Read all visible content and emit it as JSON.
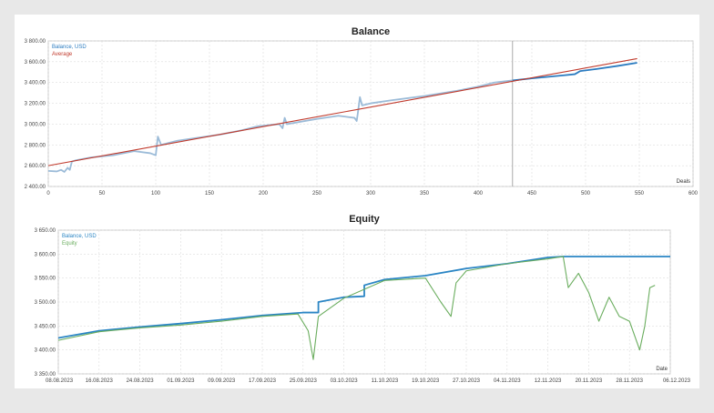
{
  "chart_data": [
    {
      "type": "line",
      "title": "Balance",
      "xlabel": "Deals",
      "xlim": [
        0,
        600
      ],
      "ylim": [
        2400,
        3800
      ],
      "x_ticks": [
        0,
        50,
        100,
        150,
        200,
        250,
        300,
        350,
        400,
        450,
        500,
        550,
        600
      ],
      "y_ticks": [
        2400,
        2600,
        2800,
        3000,
        3200,
        3400,
        3600,
        3800
      ],
      "x_tick_labels": [
        "0",
        "50",
        "100",
        "150",
        "200",
        "250",
        "300",
        "350",
        "400",
        "450",
        "500",
        "550",
        "600"
      ],
      "y_tick_labels": [
        "2 400.00",
        "2 600.00",
        "2 800.00",
        "3 000.00",
        "3 200.00",
        "3 400.00",
        "3 600.00",
        "3 800.00"
      ],
      "grid": true,
      "legend_position": "top-left",
      "divider_x": 432,
      "series": [
        {
          "name": "Balance, USD",
          "color": "#9bbbd8",
          "color_forward": "#2a7bc0",
          "points": [
            [
              0,
              2550
            ],
            [
              8,
              2545
            ],
            [
              12,
              2560
            ],
            [
              15,
              2540
            ],
            [
              18,
              2580
            ],
            [
              20,
              2560
            ],
            [
              22,
              2640
            ],
            [
              25,
              2650
            ],
            [
              40,
              2680
            ],
            [
              60,
              2700
            ],
            [
              80,
              2740
            ],
            [
              95,
              2720
            ],
            [
              100,
              2700
            ],
            [
              102,
              2880
            ],
            [
              105,
              2800
            ],
            [
              120,
              2840
            ],
            [
              140,
              2870
            ],
            [
              160,
              2900
            ],
            [
              180,
              2940
            ],
            [
              195,
              2980
            ],
            [
              215,
              3000
            ],
            [
              218,
              2960
            ],
            [
              220,
              3060
            ],
            [
              222,
              3000
            ],
            [
              250,
              3050
            ],
            [
              270,
              3080
            ],
            [
              285,
              3060
            ],
            [
              287,
              3030
            ],
            [
              288,
              3100
            ],
            [
              290,
              3260
            ],
            [
              292,
              3180
            ],
            [
              300,
              3200
            ],
            [
              320,
              3230
            ],
            [
              350,
              3270
            ],
            [
              380,
              3320
            ],
            [
              400,
              3360
            ],
            [
              415,
              3400
            ],
            [
              432,
              3420
            ],
            [
              450,
              3440
            ],
            [
              480,
              3470
            ],
            [
              490,
              3480
            ],
            [
              495,
              3510
            ],
            [
              510,
              3530
            ],
            [
              530,
              3560
            ],
            [
              548,
              3590
            ]
          ]
        },
        {
          "name": "Average",
          "color": "#c0392b",
          "points": [
            [
              0,
              2600
            ],
            [
              548,
              3630
            ]
          ]
        }
      ]
    },
    {
      "type": "line",
      "title": "Equity",
      "xlabel": "Date",
      "ylim": [
        3350,
        3650
      ],
      "categories": [
        "08.08.2023",
        "16.08.2023",
        "24.08.2023",
        "01.09.2023",
        "09.09.2023",
        "17.09.2023",
        "25.09.2023",
        "03.10.2023",
        "11.10.2023",
        "19.10.2023",
        "27.10.2023",
        "04.11.2023",
        "12.11.2023",
        "20.11.2023",
        "28.11.2023",
        "06.12.2023"
      ],
      "y_ticks": [
        3350,
        3400,
        3450,
        3500,
        3550,
        3600,
        3650
      ],
      "y_tick_labels": [
        "3 350.00",
        "3 400.00",
        "3 450.00",
        "3 500.00",
        "3 550.00",
        "3 600.00",
        "3 650.00"
      ],
      "grid": true,
      "legend_position": "top-left",
      "series": [
        {
          "name": "Balance, USD",
          "color": "#2a85c4",
          "points": [
            [
              "08.08.2023",
              3425
            ],
            [
              "16.08.2023",
              3440
            ],
            [
              "24.08.2023",
              3448
            ],
            [
              "01.09.2023",
              3455
            ],
            [
              "09.09.2023",
              3463
            ],
            [
              "17.09.2023",
              3472
            ],
            [
              "25.09.2023",
              3478
            ],
            [
              "28.09.2023",
              3478
            ],
            [
              "28.09.2023",
              3500
            ],
            [
              "03.10.2023",
              3510
            ],
            [
              "07.10.2023",
              3512
            ],
            [
              "07.10.2023",
              3535
            ],
            [
              "11.10.2023",
              3547
            ],
            [
              "19.10.2023",
              3555
            ],
            [
              "27.10.2023",
              3570
            ],
            [
              "04.11.2023",
              3580
            ],
            [
              "12.11.2023",
              3593
            ],
            [
              "15.11.2023",
              3595
            ],
            [
              "06.12.2023",
              3595
            ]
          ]
        },
        {
          "name": "Equity",
          "color": "#6aad5e",
          "points": [
            [
              "08.08.2023",
              3420
            ],
            [
              "16.08.2023",
              3438
            ],
            [
              "24.08.2023",
              3446
            ],
            [
              "01.09.2023",
              3452
            ],
            [
              "09.09.2023",
              3460
            ],
            [
              "17.09.2023",
              3470
            ],
            [
              "24.09.2023",
              3475
            ],
            [
              "26.09.2023",
              3440
            ],
            [
              "27.09.2023",
              3380
            ],
            [
              "28.09.2023",
              3470
            ],
            [
              "03.10.2023",
              3508
            ],
            [
              "11.10.2023",
              3545
            ],
            [
              "19.10.2023",
              3550
            ],
            [
              "22.10.2023",
              3500
            ],
            [
              "24.10.2023",
              3470
            ],
            [
              "25.10.2023",
              3540
            ],
            [
              "27.10.2023",
              3565
            ],
            [
              "04.11.2023",
              3580
            ],
            [
              "12.11.2023",
              3590
            ],
            [
              "15.11.2023",
              3595
            ],
            [
              "16.11.2023",
              3530
            ],
            [
              "18.11.2023",
              3560
            ],
            [
              "20.11.2023",
              3520
            ],
            [
              "22.11.2023",
              3460
            ],
            [
              "24.11.2023",
              3510
            ],
            [
              "26.11.2023",
              3470
            ],
            [
              "28.11.2023",
              3460
            ],
            [
              "30.11.2023",
              3400
            ],
            [
              "01.12.2023",
              3450
            ],
            [
              "02.12.2023",
              3530
            ],
            [
              "03.12.2023",
              3535
            ]
          ]
        }
      ]
    }
  ]
}
